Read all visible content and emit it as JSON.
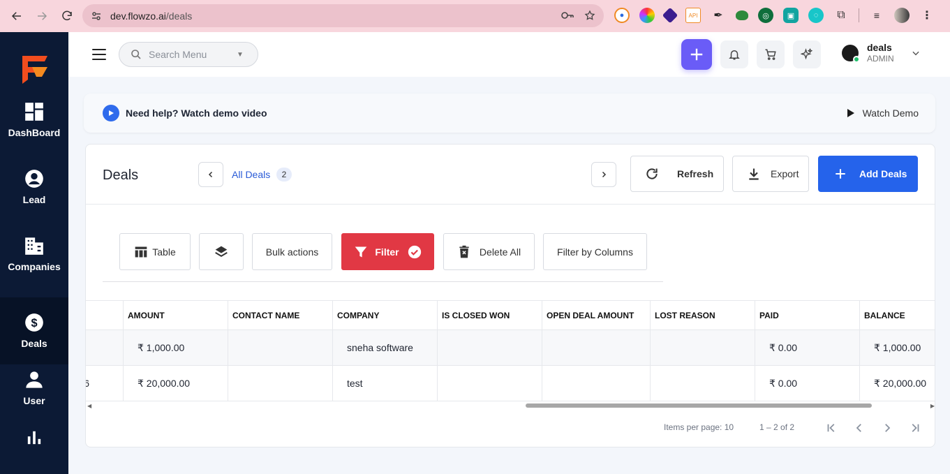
{
  "browser": {
    "url_host": "dev.flowzo.ai",
    "url_path": "/deals"
  },
  "sidebar": {
    "items": [
      {
        "label": "DashBoard",
        "icon": "dashboard-icon"
      },
      {
        "label": "Lead",
        "icon": "user-circle-icon"
      },
      {
        "label": "Companies",
        "icon": "building-icon"
      },
      {
        "label": "Deals",
        "icon": "dollar-icon",
        "active": true
      },
      {
        "label": "User",
        "icon": "user-icon"
      },
      {
        "label": "",
        "icon": "bar-chart-icon"
      }
    ]
  },
  "topbar": {
    "search_placeholder": "Search Menu",
    "user_name": "deals",
    "user_role": "ADMIN"
  },
  "help": {
    "message": "Need help? Watch demo video",
    "watch_label": "Watch Demo"
  },
  "header": {
    "title": "Deals",
    "view_label": "All Deals",
    "view_count": "2",
    "refresh_label": "Refresh",
    "export_label": "Export",
    "add_label": "Add Deals"
  },
  "toolbar": {
    "table_label": "Table",
    "bulk_label": "Bulk actions",
    "filter_label": "Filter",
    "delete_label": "Delete All",
    "filter_columns_label": "Filter by Columns"
  },
  "table": {
    "columns": [
      "",
      "AMOUNT",
      "CONTACT NAME",
      "COMPANY",
      "IS CLOSED WON",
      "OPEN DEAL AMOUNT",
      "LOST REASON",
      "PAID",
      "BALANCE"
    ],
    "rows": [
      [
        "",
        "₹ 1,000.00",
        "",
        "sneha software",
        "",
        "",
        "",
        "₹ 0.00",
        "₹ 1,000.00"
      ],
      [
        "6",
        "₹ 20,000.00",
        "",
        "test",
        "",
        "",
        "",
        "₹ 0.00",
        "₹ 20,000.00"
      ]
    ]
  },
  "pager": {
    "items_per_page": "Items per page: 10",
    "range": "1 – 2 of 2"
  },
  "colors": {
    "sidebar_bg": "#0c1a35",
    "accent_blue": "#2563eb",
    "filter_red": "#e13844",
    "purple_plus": "#6a5cf7",
    "chrome_pink": "#f8d6dd"
  }
}
